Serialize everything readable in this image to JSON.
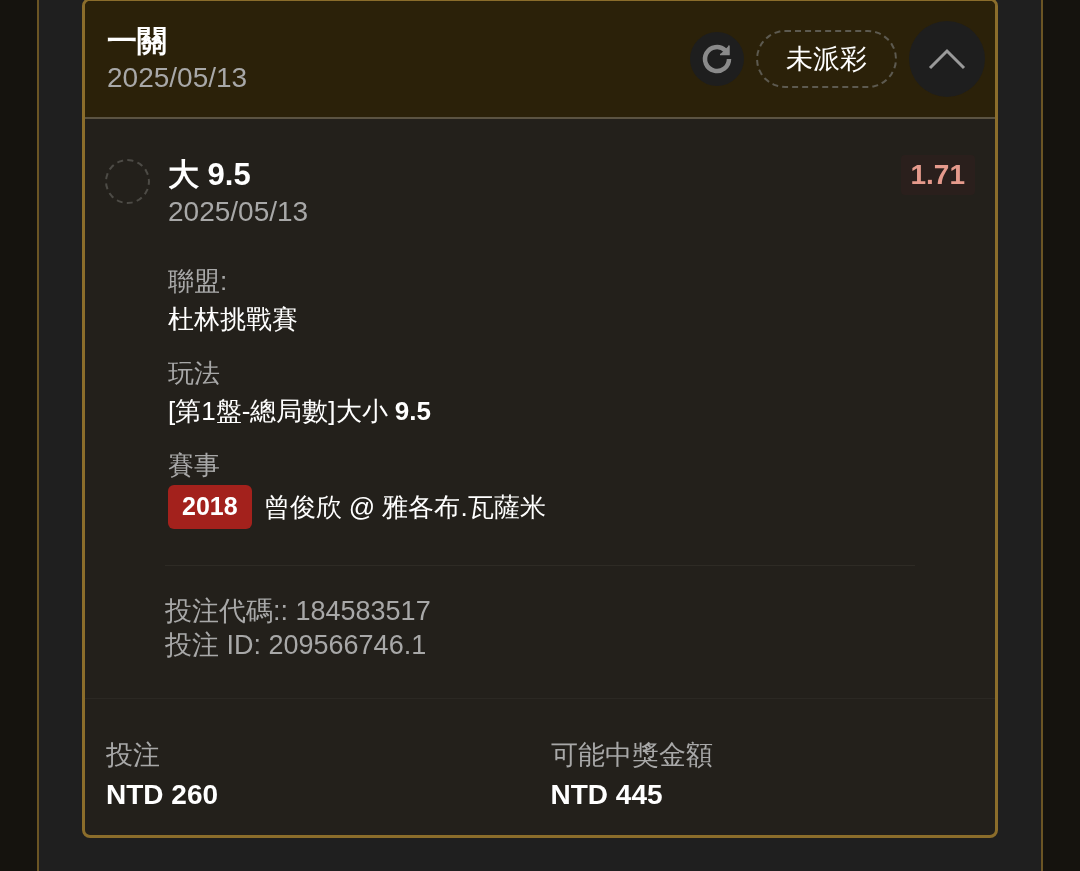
{
  "header": {
    "title": "一關",
    "date": "2025/05/13",
    "status": "未派彩",
    "expanded": true
  },
  "selection": {
    "selected": false,
    "pick": "大 9.5",
    "date": "2025/05/13",
    "odds": "1.71"
  },
  "details": [
    {
      "label": "聯盟:",
      "value": "杜林挑戰賽"
    },
    {
      "label": "玩法",
      "value": "[第1盤-總局數]大小 **9.5**"
    },
    {
      "label": "賽事",
      "badge": "2018",
      "value": "曾俊欣 @ 雅各布.瓦薩米"
    }
  ],
  "codes": [
    "投注代碼:: 184583517",
    "投注 ID: 209566746.1"
  ],
  "totals": [
    {
      "label": "投注",
      "value": "NTD 260"
    },
    {
      "label": "可能中獎金額",
      "value": "NTD 445"
    }
  ]
}
